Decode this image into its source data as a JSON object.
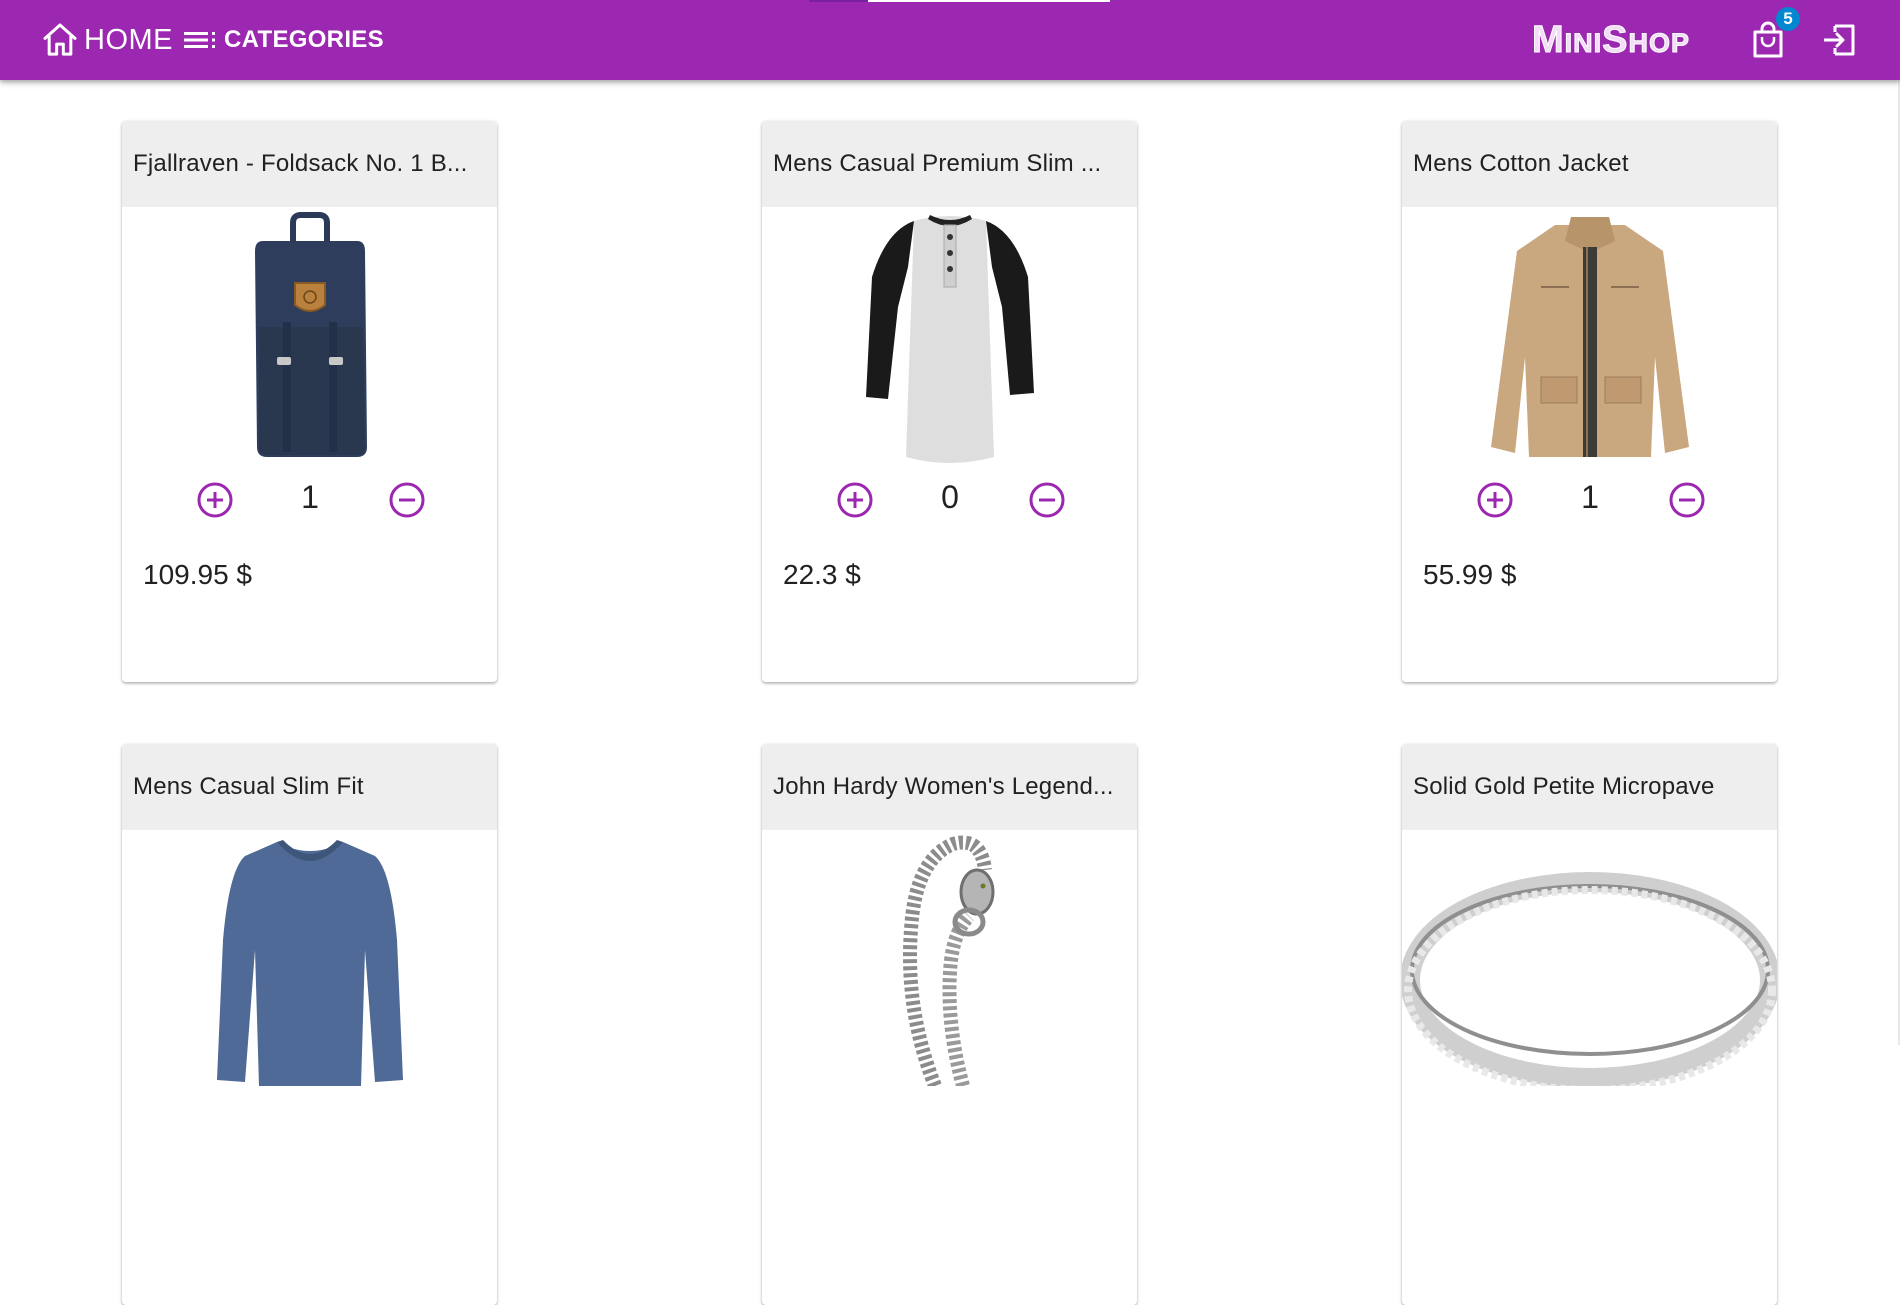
{
  "colors": {
    "appbar": "#9c27b0",
    "accent_primary": "#7b1fa2",
    "accent_indicator": "#ffffff",
    "icon_purple": "#9c27b0",
    "badge": "#0288d1",
    "card_header": "#eeeeee"
  },
  "appbar": {
    "home_label": "HOME",
    "home_icon": "home-icon",
    "categories_label": "CATEGORIES",
    "categories_icon": "list-icon",
    "brand": "MiniShop",
    "cart_icon": "shopping-bag-icon",
    "cart_count": "5",
    "logout_icon": "logout-icon"
  },
  "products": [
    {
      "title": "Fjallraven - Foldsack No. 1 B...",
      "quantity": "1",
      "price": "109.95 $",
      "image": "backpack"
    },
    {
      "title": "Mens Casual Premium Slim ...",
      "quantity": "0",
      "price": "22.3 $",
      "image": "tshirt"
    },
    {
      "title": "Mens Cotton Jacket",
      "quantity": "1",
      "price": "55.99 $",
      "image": "jacket"
    },
    {
      "title": "Mens Casual Slim Fit",
      "image": "longsleeve"
    },
    {
      "title": "John Hardy Women's Legend...",
      "image": "bracelet"
    },
    {
      "title": "Solid Gold Petite Micropave",
      "image": "ring"
    }
  ]
}
